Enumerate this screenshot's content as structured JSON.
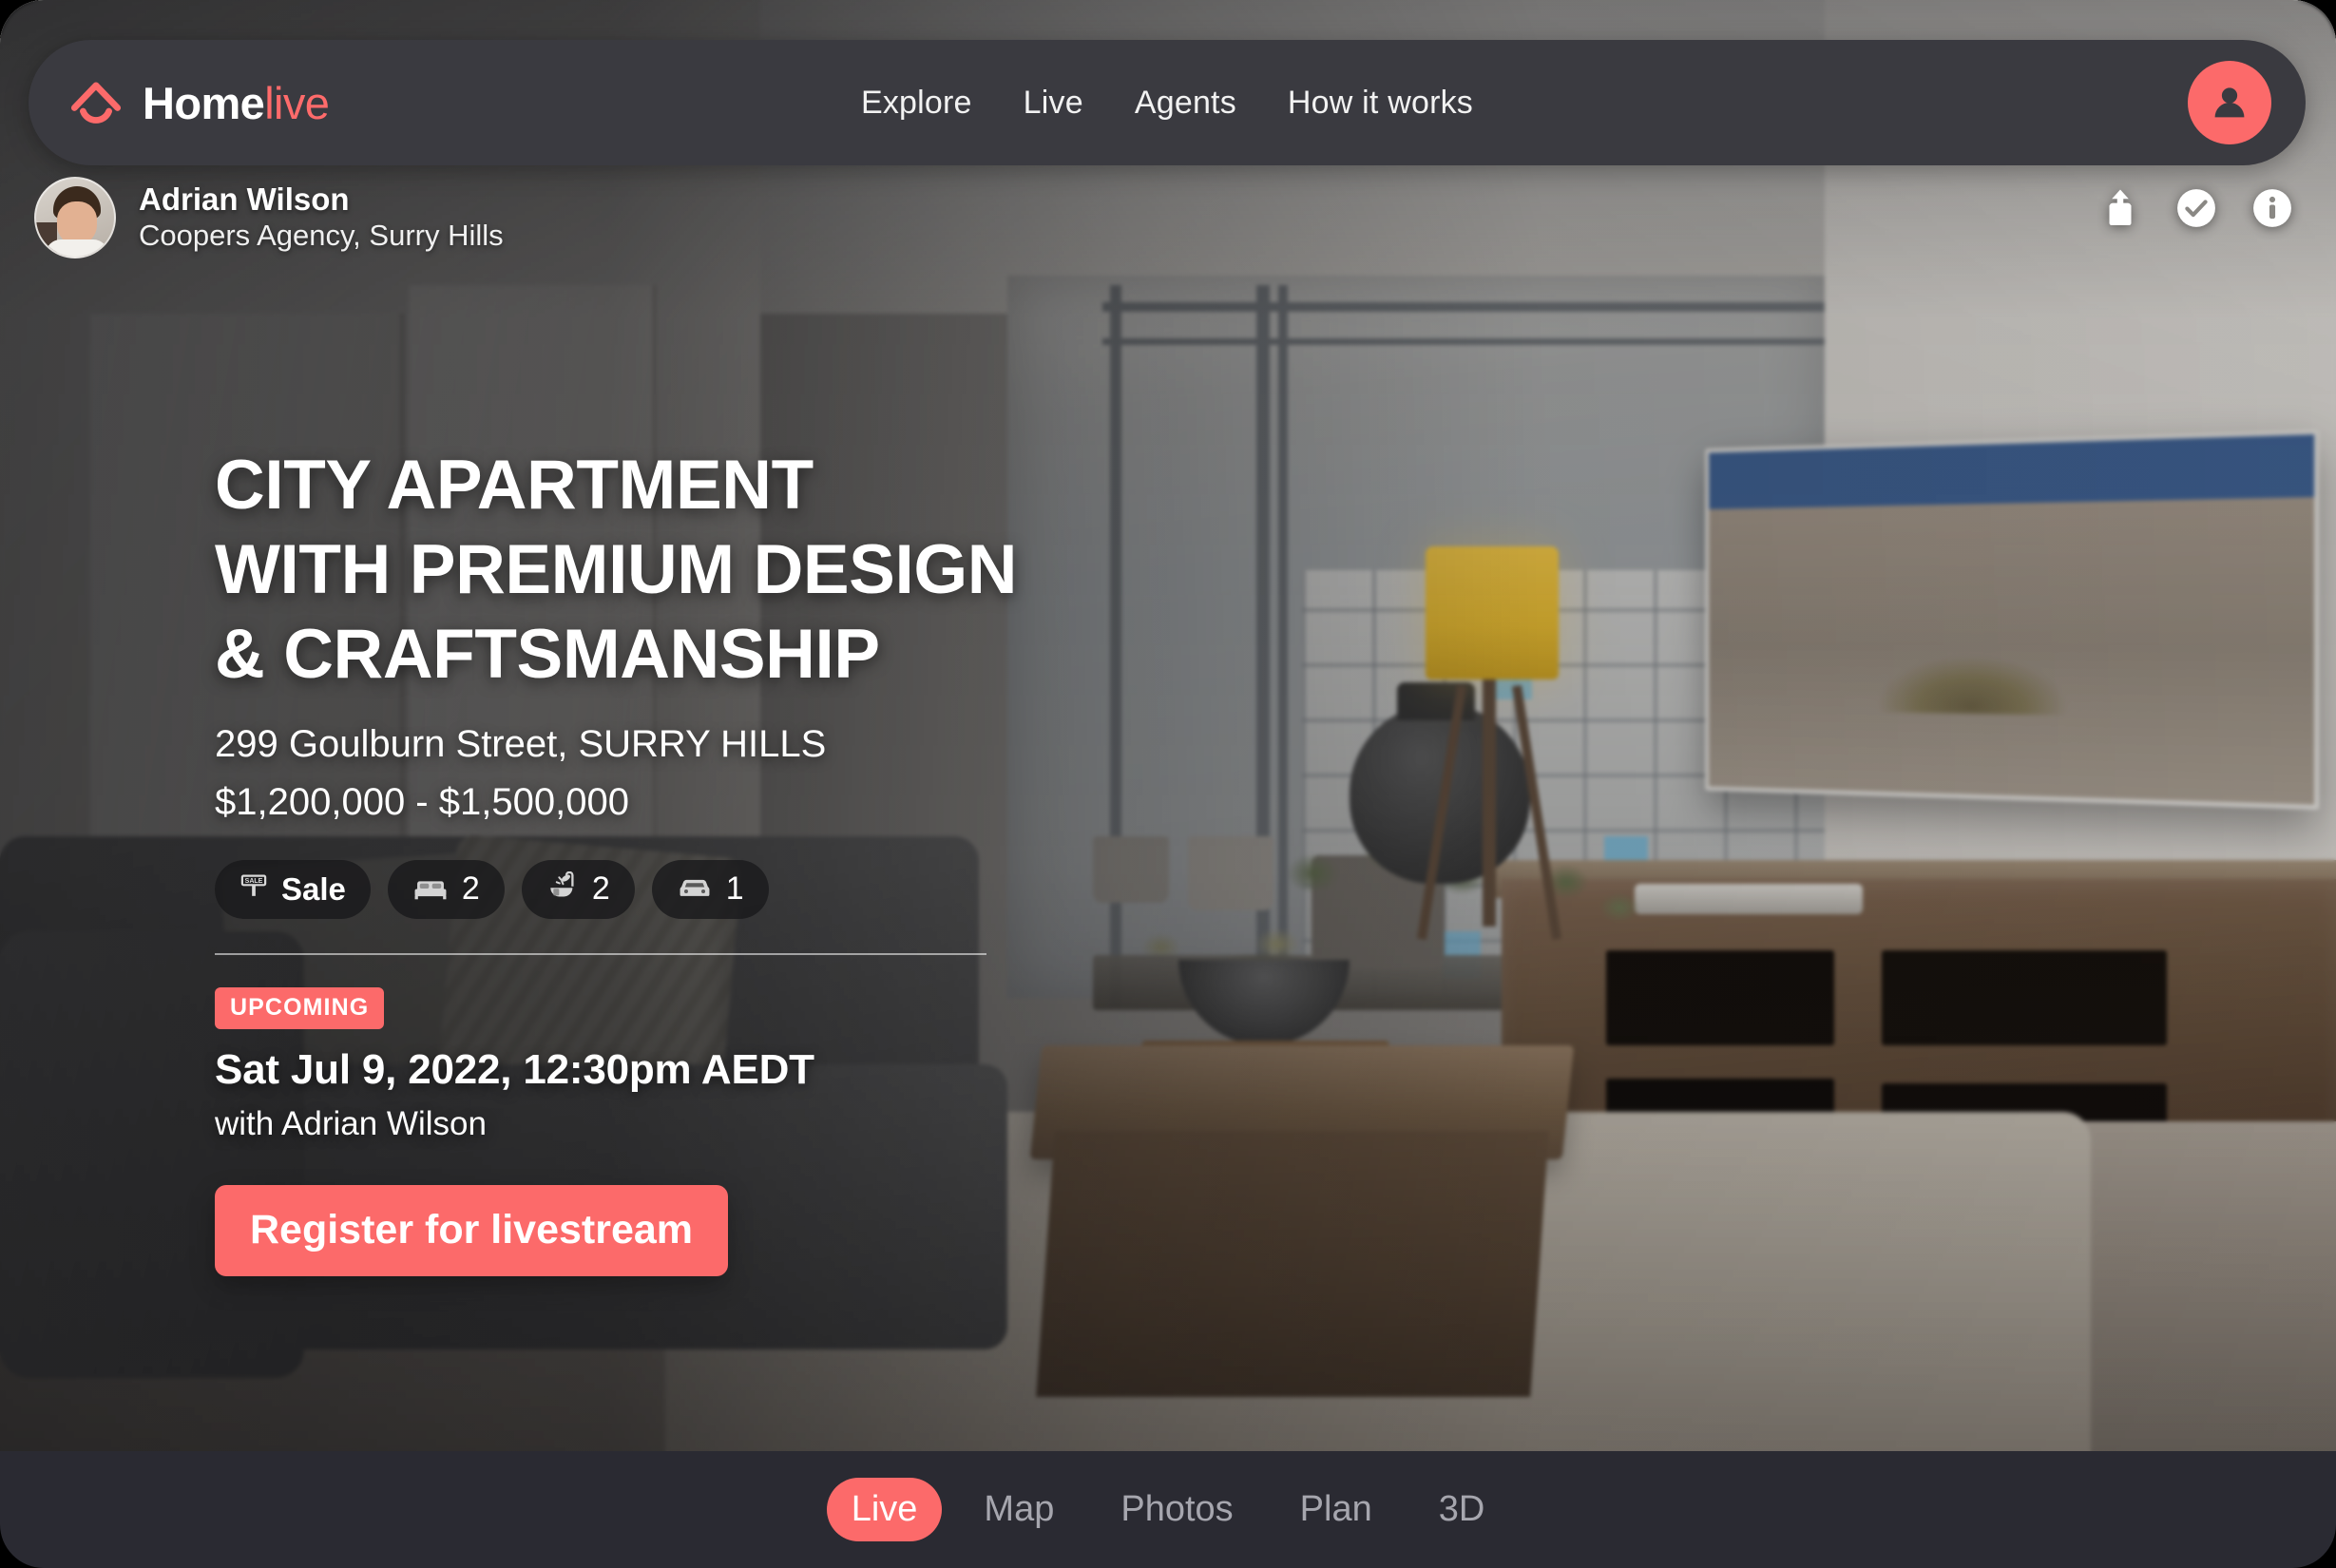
{
  "brand": {
    "name_dark": "Home",
    "name_accent": "live",
    "logo_icon": "house-roof-icon",
    "accent_color": "#fc6a6a",
    "navbar_color": "#3a3a40"
  },
  "nav": {
    "links": [
      {
        "label": "Explore"
      },
      {
        "label": "Live"
      },
      {
        "label": "Agents"
      },
      {
        "label": "How it works"
      }
    ],
    "account_icon": "user-avatar-icon"
  },
  "agent": {
    "name": "Adrian Wilson",
    "agency": "Coopers Agency, Surry Hills",
    "avatar_icon": "agent-headshot"
  },
  "actions": [
    {
      "name": "share-icon",
      "label": "Share"
    },
    {
      "name": "check-circle-icon",
      "label": "Shortlist"
    },
    {
      "name": "info-circle-icon",
      "label": "Info"
    }
  ],
  "listing": {
    "title_line_1": "CITY APARTMENT",
    "title_line_2": "WITH PREMIUM DESIGN",
    "title_line_3": "& CRAFTSMANSHIP",
    "address": "299 Goulburn Street, SURRY HILLS",
    "price": "$1,200,000 - $1,500,000",
    "badges": [
      {
        "icon": "sale-sign-icon",
        "label": "Sale"
      },
      {
        "icon": "bed-icon",
        "label": "2"
      },
      {
        "icon": "shower-icon",
        "label": "2"
      },
      {
        "icon": "car-icon",
        "label": "1"
      }
    ]
  },
  "event": {
    "status_tag": "UPCOMING",
    "datetime": "Sat Jul 9, 2022, 12:30pm AEDT",
    "host": "with Adrian Wilson",
    "cta_label": "Register for  livestream"
  },
  "tabs": [
    {
      "label": "Live",
      "active": true
    },
    {
      "label": "Map",
      "active": false
    },
    {
      "label": "Photos",
      "active": false
    },
    {
      "label": "Plan",
      "active": false
    },
    {
      "label": "3D",
      "active": false
    }
  ]
}
